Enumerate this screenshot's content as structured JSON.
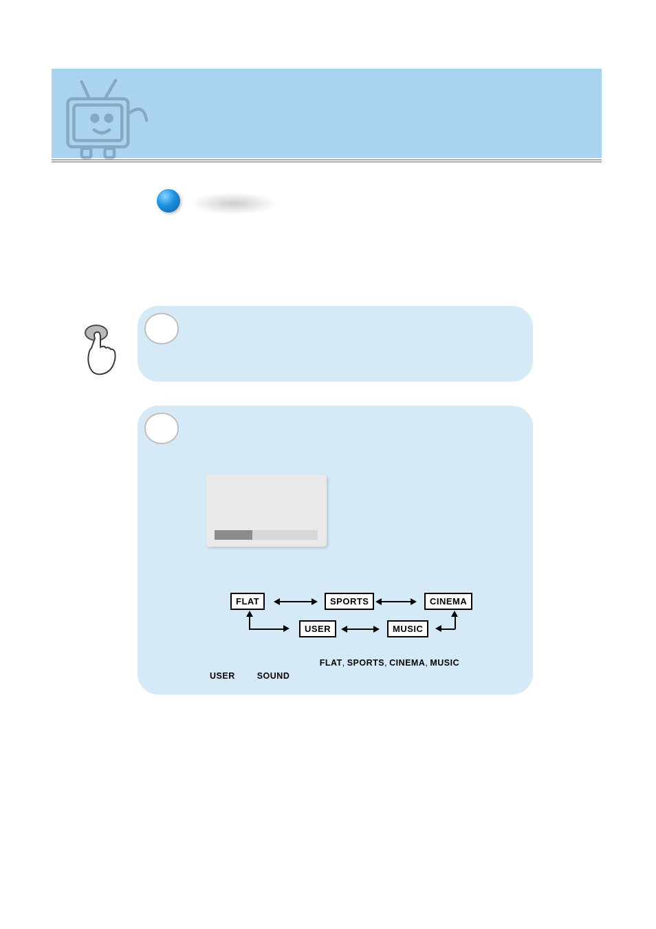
{
  "diagram": {
    "modes": [
      "FLAT",
      "SPORTS",
      "CINEMA",
      "USER",
      "MUSIC"
    ]
  },
  "sentence": {
    "w1": "FLAT",
    "w2": "SPORTS",
    "w3": "CINEMA",
    "w4": "MUSIC",
    "w5": "USER",
    "w6": "SOUND"
  }
}
